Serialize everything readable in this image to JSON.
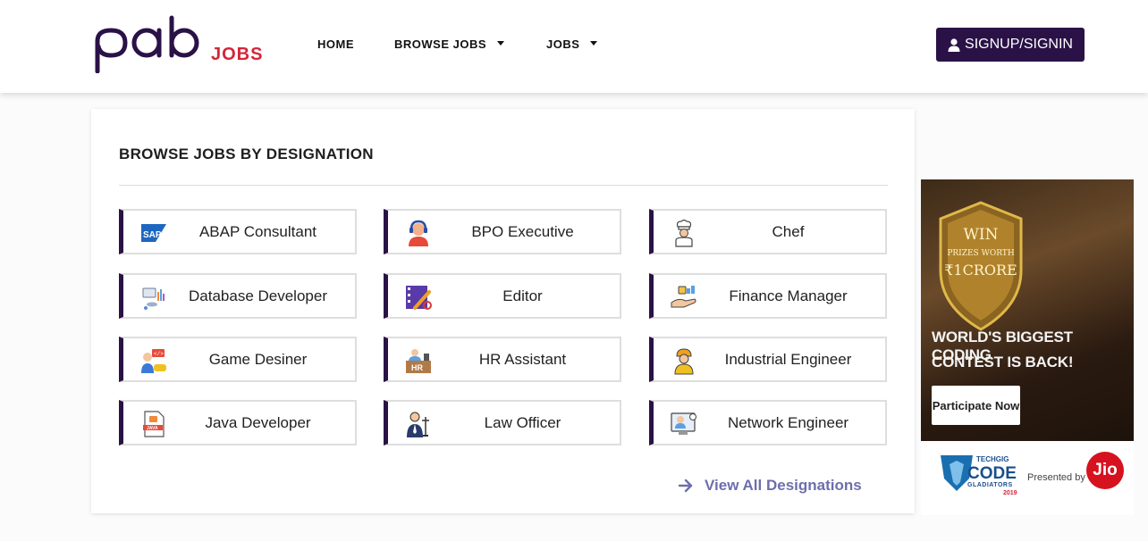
{
  "header": {
    "logo_text": "pab",
    "logo_sub": "JOBS",
    "nav": [
      {
        "label": "HOME"
      },
      {
        "label": "BROWSE JOBS"
      },
      {
        "label": "JOBS"
      }
    ],
    "signup_label": "SIGNUP/SIGNIN"
  },
  "section": {
    "title": "BROWSE JOBS BY DESIGNATION",
    "view_all": "View All Designations",
    "jobs": [
      {
        "label": "ABAP Consultant",
        "icon": "sap-icon"
      },
      {
        "label": "BPO Executive",
        "icon": "headset-agent-icon"
      },
      {
        "label": "Chef",
        "icon": "chef-icon"
      },
      {
        "label": "Database Developer",
        "icon": "database-icon"
      },
      {
        "label": "Editor",
        "icon": "film-edit-icon"
      },
      {
        "label": "Finance Manager",
        "icon": "money-hand-icon"
      },
      {
        "label": "Game Desiner",
        "icon": "gamer-icon"
      },
      {
        "label": "HR Assistant",
        "icon": "hr-desk-icon"
      },
      {
        "label": "Industrial Engineer",
        "icon": "engineer-helmet-icon"
      },
      {
        "label": "Java Developer",
        "icon": "java-file-icon"
      },
      {
        "label": "Law Officer",
        "icon": "lawyer-icon"
      },
      {
        "label": "Network Engineer",
        "icon": "network-monitor-icon"
      }
    ]
  },
  "ad": {
    "badge_line1": "WIN",
    "badge_line2": "PRIZES WORTH",
    "badge_line3": "₹1CRORE",
    "headline1": "WORLD'S BIGGEST CODING",
    "headline2": "CONTEST IS BACK!",
    "button": "Participate Now",
    "brand_small": "TECHGIG",
    "brand_main": "CODE",
    "brand_sub": "GLADIATORS",
    "brand_year": "2019",
    "presented_by": "Presented by",
    "sponsor": "Jio"
  }
}
